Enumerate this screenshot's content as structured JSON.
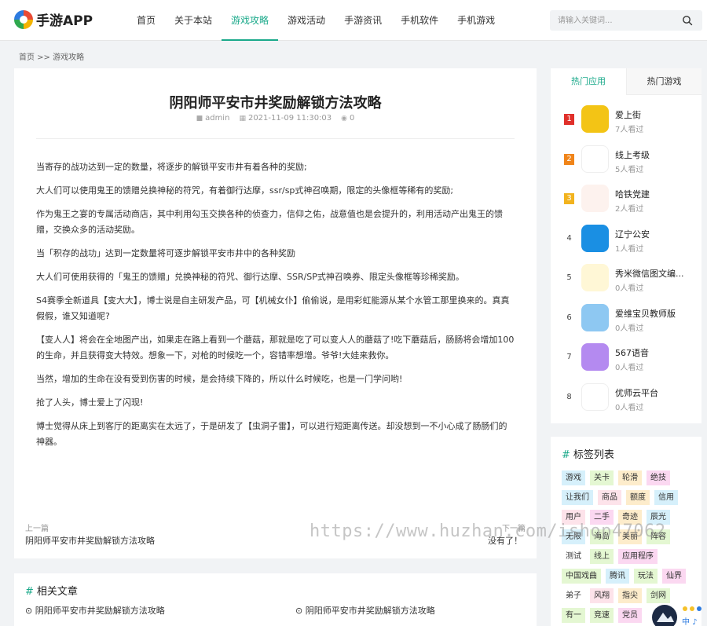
{
  "header": {
    "logo_text": "手游APP",
    "nav": [
      "首页",
      "关于本站",
      "游戏攻略",
      "游戏活动",
      "手游资讯",
      "手机软件",
      "手机游戏"
    ],
    "active_nav": "游戏攻略",
    "search_placeholder": "请输入关键词..."
  },
  "breadcrumb": "首页 >> 游戏攻略",
  "article": {
    "title": "阴阳师平安市井奖励解锁方法攻略",
    "author": "admin",
    "date": "2021-11-09 11:30:03",
    "views": "0",
    "paragraphs": [
      "当寄存的战功达到一定的数量，将逐步的解锁平安市井有着各种的奖励;",
      "大人们可以使用鬼王的馈赠兑换神秘的符咒，有着御行达摩，ssr/sp式神召唤期，限定的头像框等稀有的奖励;",
      "作为鬼王之宴的专属活动商店，其中利用勾玉交换各种的侦查力，信仰之佑，战意值也是会提升的，利用活动产出鬼王的馈赠，交换众多的活动奖励。",
      "当「积存的战功」达到一定数量将可逐步解锁平安市井中的各种奖励",
      "大人们可使用获得的「鬼王的馈赠」兑换神秘的符咒、御行达摩、SSR/SP式神召唤券、限定头像框等珍稀奖励。",
      "S4赛季全新道具【变大大】，博士说是自主研发产品，可【机械女仆】偷偷说，是用彩虹能源从某个水管工那里换来的。真真假假，谁又知道呢?",
      "【变人人】将会在全地图产出，如果走在路上看到一个蘑菇，那就是吃了可以变人人的蘑菇了!吃下蘑菇后，肠肠将会增加100的生命，并且获得变大特效。想象一下，对枪的时候吃一个，容错率想增。爷爷!大娃来救你。",
      "当然，增加的生命在没有受到伤害的时候，是会持续下降的，所以什么时候吃，也是一门学问哟!",
      "抢了人头，博士爱上了闪现!",
      "博士觉得从床上到客厅的距离实在太远了，于是研发了【虫洞子雷】，可以进行短距离传送。却没想到一不小心成了肠肠们的神器。"
    ],
    "prev_label": "上一篇",
    "prev_link": "阴阳师平安市井奖励解锁方法攻略",
    "next_label": "下一篇",
    "next_link": "没有了！"
  },
  "related": {
    "title": "相关文章",
    "items": [
      "阴阳师平安市井奖励解锁方法攻略",
      "阴阳师平安市井奖励解锁方法攻略"
    ]
  },
  "sidebar": {
    "tabs": [
      "热门应用",
      "热门游戏"
    ],
    "apps": [
      {
        "rank": "1",
        "name": "爱上街",
        "views": "7人看过",
        "color": "#f3c415"
      },
      {
        "rank": "2",
        "name": "线上考级",
        "views": "5人看过",
        "color": "#ffffff"
      },
      {
        "rank": "3",
        "name": "哈铁党建",
        "views": "2人看过",
        "color": "#fdf2ee"
      },
      {
        "rank": "4",
        "name": "辽宁公安",
        "views": "1人看过",
        "color": "#1a8fe3"
      },
      {
        "rank": "5",
        "name": "秀米微信图文编...",
        "views": "0人看过",
        "color": "#fff7d6"
      },
      {
        "rank": "6",
        "name": "爱维宝贝教师版",
        "views": "0人看过",
        "color": "#8ec8f2"
      },
      {
        "rank": "7",
        "name": "567语音",
        "views": "0人看过",
        "color": "#b48af0"
      },
      {
        "rank": "8",
        "name": "优师云平台",
        "views": "0人看过",
        "color": "#ffffff"
      }
    ]
  },
  "tags": {
    "title": "标签列表",
    "items": [
      {
        "text": "游戏",
        "bg": "#d6f0fb"
      },
      {
        "text": "关卡",
        "bg": "#e4f7d2"
      },
      {
        "text": "轮滑",
        "bg": "#fdeccb"
      },
      {
        "text": "绝技",
        "bg": "#fbd8f1"
      },
      {
        "text": "让我们",
        "bg": "#d6f0fb"
      },
      {
        "text": "商品",
        "bg": "#fde3ea"
      },
      {
        "text": "额度",
        "bg": "#fdeccb"
      },
      {
        "text": "信用",
        "bg": "#d6f0fb"
      },
      {
        "text": "用户",
        "bg": "#fde3ea"
      },
      {
        "text": "二手",
        "bg": "#fbd8f1"
      },
      {
        "text": "奇迹",
        "bg": "#fdeccb"
      },
      {
        "text": "辰光",
        "bg": "#d6f0fb"
      },
      {
        "text": "无限",
        "bg": "#d6f0fb"
      },
      {
        "text": "海岛",
        "bg": "#e4f7d2"
      },
      {
        "text": "美丽",
        "bg": "#fdeccb"
      },
      {
        "text": "阵容",
        "bg": "#e4f7d2"
      },
      {
        "text": "测试",
        "bg": "#ffffff"
      },
      {
        "text": "线上",
        "bg": "#e4f7d2"
      },
      {
        "text": "应用程序",
        "bg": "#fbd8f1"
      },
      {
        "text": "中国戏曲",
        "bg": "#e4f7d2"
      },
      {
        "text": "腾讯",
        "bg": "#d6f0fb"
      },
      {
        "text": "玩法",
        "bg": "#e4f7d2"
      },
      {
        "text": "仙界",
        "bg": "#fbd8f1"
      },
      {
        "text": "弟子",
        "bg": "#ffffff"
      },
      {
        "text": "风翔",
        "bg": "#fde3ea"
      },
      {
        "text": "指尖",
        "bg": "#fdeccb"
      },
      {
        "text": "剑网",
        "bg": "#e4f7d2"
      },
      {
        "text": "有一",
        "bg": "#e4f7d2"
      },
      {
        "text": "竞速",
        "bg": "#e4f7d2"
      },
      {
        "text": "党员",
        "bg": "#fbd8f1"
      }
    ]
  },
  "watermark": "https://www.huzhan.com/ishop47062",
  "colors": {
    "accent": "#1aa98a"
  }
}
